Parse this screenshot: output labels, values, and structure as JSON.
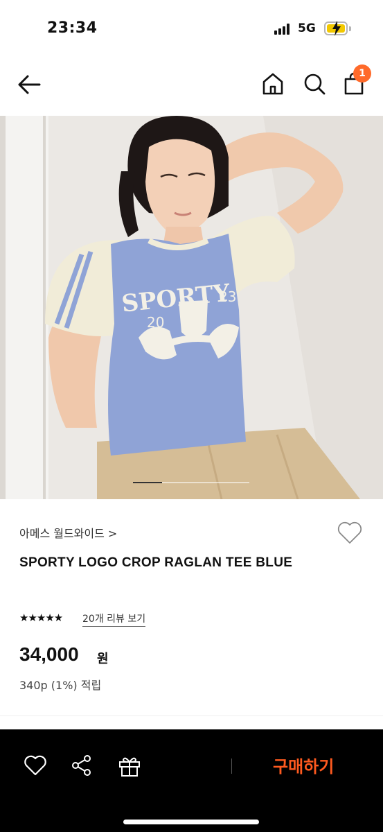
{
  "status": {
    "time": "23:34",
    "network": "5G"
  },
  "nav": {
    "cart_count": "1"
  },
  "hero": {
    "shirt_print_line1": "SPORTY",
    "shirt_print_year_left": "20",
    "shirt_print_year_right": "23",
    "image_index": 1,
    "image_count": 4
  },
  "product": {
    "brand": "아메스 월드와이드 >",
    "title": "SPORTY LOGO CROP RAGLAN TEE BLUE",
    "stars": "★★★★★",
    "reviews_link": "20개 리뷰 보기",
    "price": "34,000",
    "price_unit": "원",
    "points": "340p (1%) 적립"
  },
  "bottom": {
    "buy_label": "구매하기"
  },
  "colors": {
    "accent": "#ff5a1f",
    "badge": "#ff6a2a",
    "shirt": "#8fa3d6",
    "sleeve": "#f1ecd8"
  },
  "icons": [
    "back-arrow-icon",
    "home-icon",
    "search-icon",
    "cart-icon",
    "heart-icon",
    "share-icon",
    "gift-icon"
  ]
}
